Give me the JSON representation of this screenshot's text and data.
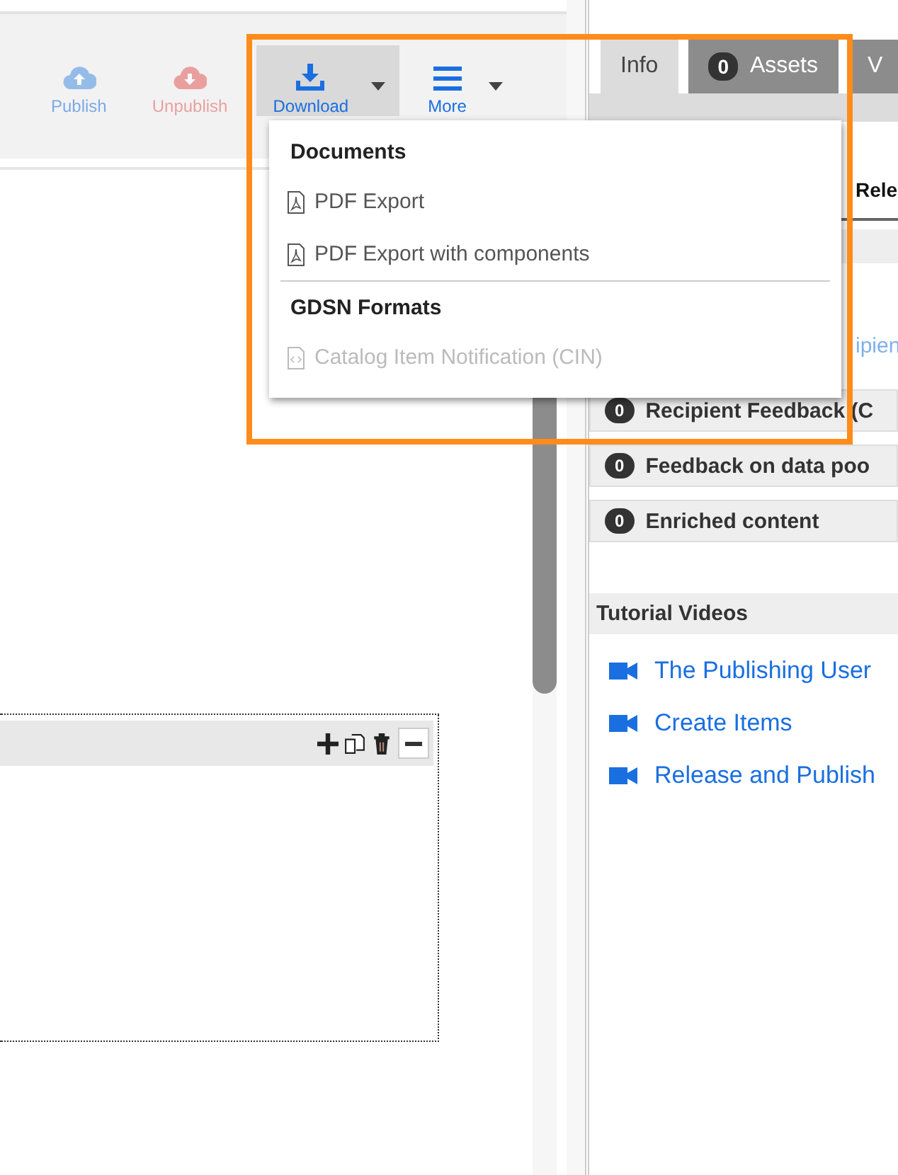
{
  "toolbar": {
    "buttons": [
      {
        "kind": "publish",
        "label": "Publish",
        "disabled": true,
        "selected": false,
        "dropdown": false
      },
      {
        "kind": "unpublish",
        "label": "Unpublish",
        "disabled": true,
        "selected": false,
        "dropdown": false
      },
      {
        "kind": "download",
        "label": "Download",
        "disabled": false,
        "selected": true,
        "dropdown": true
      },
      {
        "kind": "more",
        "label": "More",
        "disabled": false,
        "selected": false,
        "dropdown": true
      }
    ]
  },
  "download_menu": {
    "sections": [
      {
        "title": "Documents",
        "items": [
          {
            "kind": "pdf",
            "label": "PDF Export",
            "disabled": false
          },
          {
            "kind": "pdf",
            "label": "PDF Export with components",
            "disabled": false
          }
        ]
      },
      {
        "title": "GDSN Formats",
        "items": [
          {
            "kind": "code",
            "label": "Catalog Item Notification (CIN)",
            "disabled": true
          }
        ]
      }
    ]
  },
  "side_panel": {
    "tabs": [
      {
        "label": "Info",
        "selected": true
      },
      {
        "label": "Assets",
        "count": "0",
        "selected": false
      },
      {
        "label": "V",
        "selected": false
      }
    ],
    "release_heading": "Rele",
    "recipient_link": "ipien",
    "feedback_rows": [
      {
        "count": "0",
        "label": "Recipient Feedback (C"
      },
      {
        "count": "0",
        "label": "Feedback on data poo"
      },
      {
        "count": "0",
        "label": "Enriched content"
      }
    ],
    "tutorial_videos": {
      "title": "Tutorial Videos",
      "links": [
        "The Publishing User",
        "Create Items",
        "Release and Publish"
      ]
    }
  }
}
